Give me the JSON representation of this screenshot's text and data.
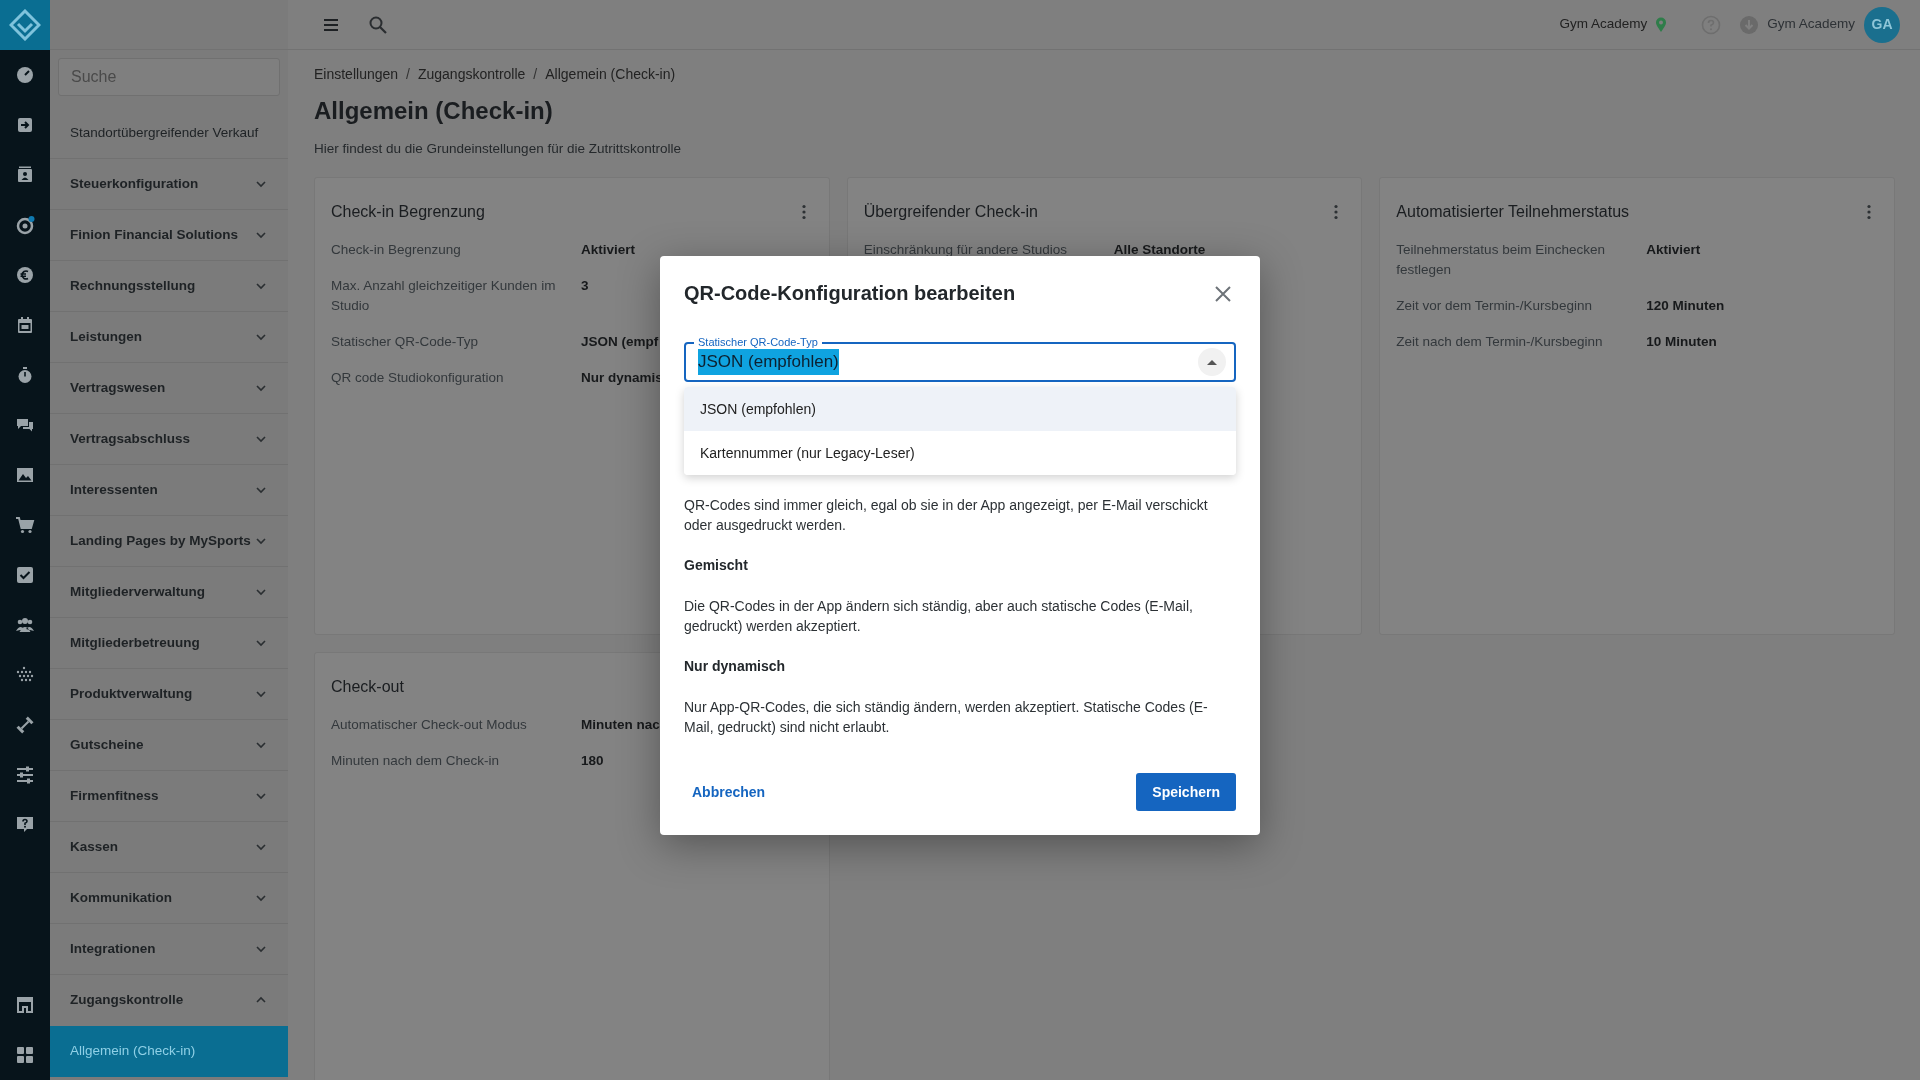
{
  "topbar": {
    "location": "Gym Academy",
    "user_name": "Gym Academy",
    "avatar_initials": "GA"
  },
  "sidebar": {
    "search_placeholder": "Suche",
    "items": [
      {
        "label": "Standortübergreifender Verkauf",
        "expandable": false
      },
      {
        "label": "Steuerkonfiguration",
        "expandable": true,
        "expanded": false
      },
      {
        "label": "Finion Financial Solutions",
        "expandable": true,
        "expanded": false
      },
      {
        "label": "Rechnungsstellung",
        "expandable": true,
        "expanded": false
      },
      {
        "label": "Leistungen",
        "expandable": true,
        "expanded": false
      },
      {
        "label": "Vertragswesen",
        "expandable": true,
        "expanded": false
      },
      {
        "label": "Vertragsabschluss",
        "expandable": true,
        "expanded": false
      },
      {
        "label": "Interessenten",
        "expandable": true,
        "expanded": false
      },
      {
        "label": "Landing Pages by MySports",
        "expandable": true,
        "expanded": false
      },
      {
        "label": "Mitgliederverwaltung",
        "expandable": true,
        "expanded": false
      },
      {
        "label": "Mitgliederbetreuung",
        "expandable": true,
        "expanded": false
      },
      {
        "label": "Produktverwaltung",
        "expandable": true,
        "expanded": false
      },
      {
        "label": "Gutscheine",
        "expandable": true,
        "expanded": false
      },
      {
        "label": "Firmenfitness",
        "expandable": true,
        "expanded": false
      },
      {
        "label": "Kassen",
        "expandable": true,
        "expanded": false
      },
      {
        "label": "Kommunikation",
        "expandable": true,
        "expanded": false
      },
      {
        "label": "Integrationen",
        "expandable": true,
        "expanded": false
      },
      {
        "label": "Zugangskontrolle",
        "expandable": true,
        "expanded": true,
        "children": [
          {
            "label": "Allgemein (Check-in)",
            "selected": true
          }
        ]
      }
    ]
  },
  "breadcrumb": [
    "Einstellungen",
    "Zugangskontrolle",
    "Allgemein (Check-in)"
  ],
  "breadcrumb_separator": "/",
  "title": "Allgemein (Check-in)",
  "subtitle": "Hier findest du die Grundeinstellungen für die Zutrittskontrolle",
  "cards": [
    {
      "title": "Check-in Begrenzung",
      "rows": [
        {
          "label": "Check-in Begrenzung",
          "value": "Aktiviert"
        },
        {
          "label": "Max. Anzahl gleichzeitiger Kunden im Studio",
          "value": "3"
        },
        {
          "label": "Statischer QR-Code-Typ",
          "value": "JSON (empf"
        },
        {
          "label": "QR code Studiokonfiguration",
          "value": "Nur dynamis"
        }
      ]
    },
    {
      "title": "Übergreifender Check-in",
      "rows": [
        {
          "label": "Einschränkung für andere Studios",
          "value": "Alle Standorte"
        }
      ]
    },
    {
      "title": "Automatisierter Teilnehmerstatus",
      "rows": [
        {
          "label": "Teilnehmerstatus beim Einchecken festlegen",
          "value": "Aktiviert"
        },
        {
          "label": "Zeit vor dem Termin-/Kursbeginn",
          "value": "120 Minuten"
        },
        {
          "label": "Zeit nach dem Termin-/Kursbeginn",
          "value": "10 Minuten"
        }
      ]
    },
    {
      "title": "Check-out",
      "rows": [
        {
          "label": "Automatischer Check-out Modus",
          "value": "Minuten nac"
        },
        {
          "label": "Minuten nach dem Check-in",
          "value": "180"
        }
      ]
    }
  ],
  "modal": {
    "title": "QR-Code-Konfiguration bearbeiten",
    "field": {
      "label": "Statischer QR-Code-Typ",
      "value": "JSON (empfohlen)",
      "value_highlighted": true,
      "expanded": true
    },
    "options": [
      {
        "label": "JSON (empfohlen)",
        "selected": true
      },
      {
        "label": "Kartennummer (nur Legacy-Leser)",
        "selected": false
      }
    ],
    "sections": [
      {
        "kind": "paragraph",
        "text": "QR-Codes sind immer gleich, egal ob sie in der App angezeigt, per E-Mail verschickt oder ausgedruckt werden."
      },
      {
        "kind": "heading",
        "text": "Gemischt"
      },
      {
        "kind": "paragraph",
        "text": "Die QR-Codes in der App ändern sich ständig, aber auch statische Codes (E-Mail, gedruckt) werden akzeptiert."
      },
      {
        "kind": "heading",
        "text": "Nur dynamisch"
      },
      {
        "kind": "paragraph",
        "text": "Nur App-QR-Codes, die sich ständig ändern, werden akzeptiert. Statische Codes (E-Mail, gedruckt) sind nicht erlaubt."
      }
    ],
    "cancel": "Abbrechen",
    "save": "Speichern"
  }
}
